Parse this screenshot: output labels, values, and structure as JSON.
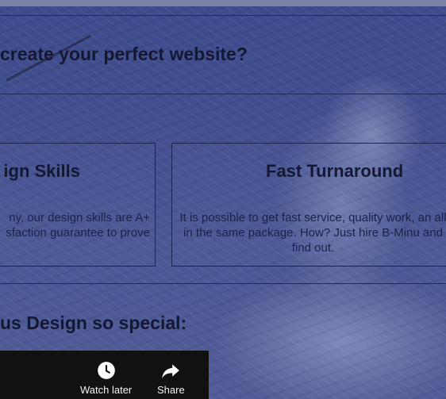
{
  "headline": "create your perfect website?",
  "cards": [
    {
      "title": "ign Skills",
      "body": [
        "ny, our design skills are A+",
        "sfaction guarantee to prove"
      ]
    },
    {
      "title": "Fast Turnaround",
      "body": "It is possible to get fast service, quality work, an all in the same package. How? Just hire B-Minu and find out."
    }
  ],
  "section_heading": "us Design so special:",
  "video_controls": {
    "watch_later": {
      "label": "Watch later",
      "icon": "clock-icon"
    },
    "share": {
      "label": "Share",
      "icon": "share-arrow-icon"
    }
  },
  "colors": {
    "overlay": "#4a5790",
    "text_dark": "#141833",
    "video_bar": "#111111"
  }
}
